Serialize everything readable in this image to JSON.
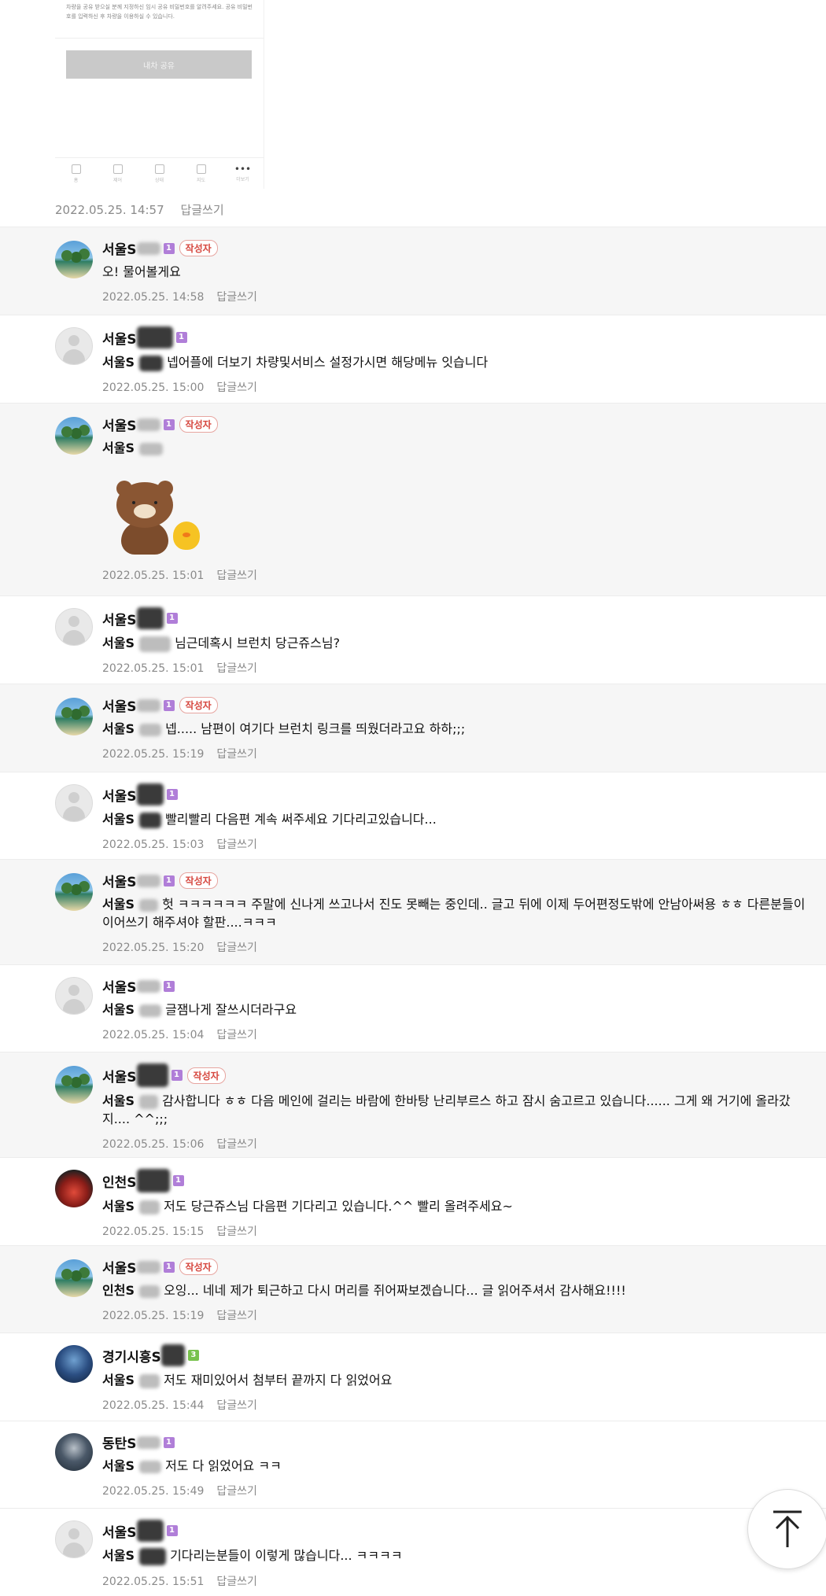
{
  "embedded_screenshot": {
    "notice": "차량을 공유 받으실 분께 지정하신 임시 공유 비밀번호를 알려주세요. 공유 비밀번호를 입력하신 후 차량을 이용하실 수 있습니다.",
    "share_button": "내차 공유",
    "tabs": [
      "홈",
      "제어",
      "상태",
      "지도",
      "더보기"
    ]
  },
  "post_meta": {
    "date": "2022.05.25. 14:57",
    "reply": "답글쓰기"
  },
  "writer_badge": "작성자",
  "reply_label": "답글쓰기",
  "comments": [
    {
      "nick": "서울S",
      "level": "1",
      "is_author": true,
      "mention": "",
      "text": "오! 물어볼게요",
      "date": "2022.05.25. 14:58"
    },
    {
      "nick": "서울S",
      "level": "1",
      "is_author": false,
      "mention": "서울S",
      "text": "넵어플에 더보기 차량및서비스 설정가시면 해당메뉴 잇습니다",
      "date": "2022.05.25. 15:00"
    },
    {
      "nick": "서울S",
      "level": "1",
      "is_author": true,
      "mention": "서울S",
      "text": "",
      "date": "2022.05.25. 15:01",
      "sticker": "bear-and-chick-sticker"
    },
    {
      "nick": "서울S",
      "level": "1",
      "is_author": false,
      "mention": "서울S",
      "text": "님근데혹시 브런치 당근쥬스님?",
      "date": "2022.05.25. 15:01"
    },
    {
      "nick": "서울S",
      "level": "1",
      "is_author": true,
      "mention": "서울S",
      "text": "넵..... 남편이 여기다 브런치 링크를 띄웠더라고요 하하;;;",
      "date": "2022.05.25. 15:19"
    },
    {
      "nick": "서울S",
      "level": "1",
      "is_author": false,
      "mention": "서울S",
      "text": "빨리빨리 다음편 계속 써주세요 기다리고있습니다...",
      "date": "2022.05.25. 15:03"
    },
    {
      "nick": "서울S",
      "level": "1",
      "is_author": true,
      "mention": "서울S",
      "text": "헛 ㅋㅋㅋㅋㅋㅋ 주말에 신나게 쓰고나서 진도 못빼는 중인데.. 글고 뒤에 이제 두어편정도밖에 안남아써용 ㅎㅎ 다른분들이 이어쓰기 해주셔야 할판....ㅋㅋㅋ",
      "date": "2022.05.25. 15:20"
    },
    {
      "nick": "서울S",
      "level": "1",
      "is_author": false,
      "mention": "서울S",
      "text": "글잼나게 잘쓰시더라구요",
      "date": "2022.05.25. 15:04"
    },
    {
      "nick": "서울S",
      "level": "1",
      "is_author": true,
      "mention": "서울S",
      "text": "감사합니다 ㅎㅎ 다음 메인에 걸리는 바람에 한바탕 난리부르스 하고 잠시 숨고르고 있습니다...... 그게 왜 거기에 올라갔지.... ^^;;;",
      "date": "2022.05.25. 15:06"
    },
    {
      "nick": "인천S",
      "level": "1",
      "is_author": false,
      "mention": "서울S",
      "text": "저도 당근쥬스님 다음편 기다리고 있습니다.^^ 빨리 올려주세요~",
      "date": "2022.05.25. 15:15"
    },
    {
      "nick": "서울S",
      "level": "1",
      "is_author": true,
      "mention": "인천S",
      "text": "오잉... 네네 제가 퇴근하고 다시 머리를 쥐어짜보겠습니다... 글 읽어주셔서 감사해요!!!!",
      "date": "2022.05.25. 15:19"
    },
    {
      "nick": "경기시흥S",
      "level": "3",
      "is_author": false,
      "mention": "서울S",
      "text": "저도 재미있어서 첨부터 끝까지 다 읽었어요",
      "date": "2022.05.25. 15:44"
    },
    {
      "nick": "동탄S",
      "level": "1",
      "is_author": false,
      "mention": "서울S",
      "text": "저도 다 읽었어요 ㅋㅋ",
      "date": "2022.05.25. 15:49"
    },
    {
      "nick": "서울S",
      "level": "1",
      "is_author": false,
      "mention": "서울S",
      "text": "기다리는분들이 이렇게 많습니다... ㅋㅋㅋㅋ",
      "date": "2022.05.25. 15:51"
    }
  ],
  "icons": {
    "scroll_top": "arrow-up-to-top-icon"
  }
}
